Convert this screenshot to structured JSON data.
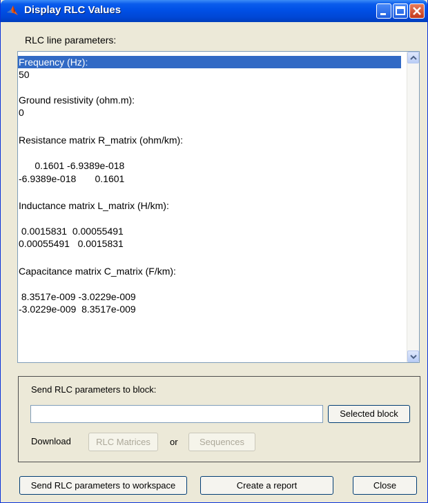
{
  "window": {
    "title": "Display RLC Values"
  },
  "header_label": "RLC line parameters:",
  "params_list": [
    "Frequency (Hz):",
    "50",
    "",
    "Ground resistivity (ohm.m):",
    "0",
    "",
    "Resistance matrix R_matrix (ohm/km):",
    "",
    "      0.1601 -6.9389e-018",
    "-6.9389e-018       0.1601",
    "",
    "Inductance matrix L_matrix (H/km):",
    "",
    " 0.0015831  0.00055491",
    "0.00055491   0.0015831",
    "",
    "Capacitance matrix C_matrix (F/km):",
    "",
    " 8.3517e-009 -3.0229e-009",
    "-3.0229e-009  8.3517e-009"
  ],
  "send_group": {
    "label": "Send RLC parameters to block:",
    "input_value": "",
    "selected_block_label": "Selected block",
    "download_label": "Download",
    "rlc_matrices_label": "RLC Matrices",
    "or_label": "or",
    "sequences_label": "Sequences"
  },
  "footer": {
    "send_workspace_label": "Send RLC parameters to workspace",
    "create_report_label": "Create a report",
    "close_label": "Close"
  },
  "colors": {
    "titlebar": "#0054e3",
    "selection": "#316ac5",
    "dialog_bg": "#ece9d8"
  },
  "icons": [
    "matlab-icon",
    "minimize-icon",
    "maximize-icon",
    "close-icon",
    "scroll-up-icon",
    "scroll-down-icon"
  ]
}
